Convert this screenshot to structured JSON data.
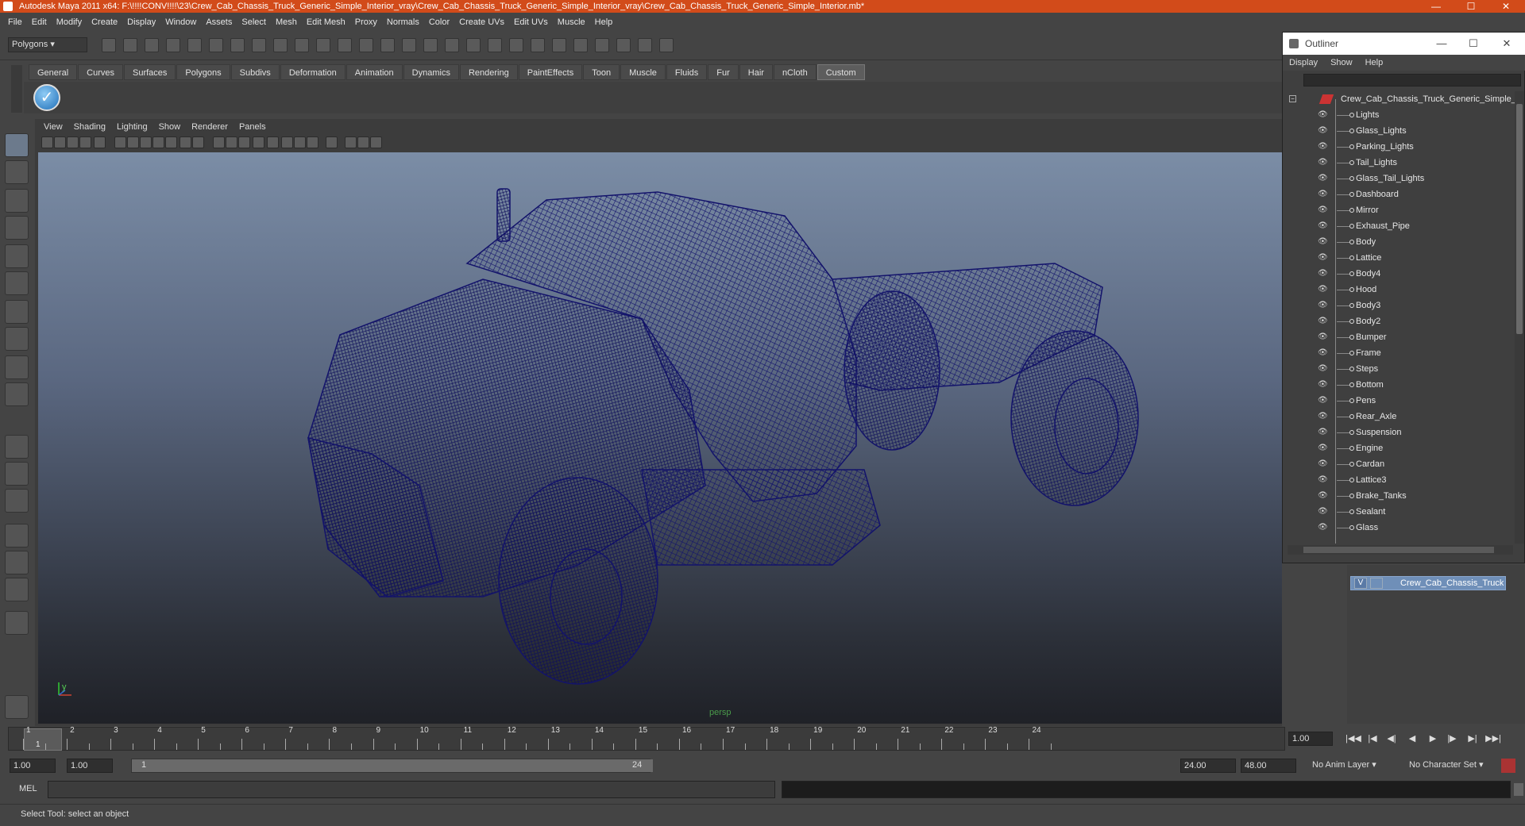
{
  "window": {
    "title": "Autodesk Maya 2011 x64: F:\\!!!!CONV!!!!\\23\\Crew_Cab_Chassis_Truck_Generic_Simple_Interior_vray\\Crew_Cab_Chassis_Truck_Generic_Simple_Interior_vray\\Crew_Cab_Chassis_Truck_Generic_Simple_Interior.mb*",
    "controls": {
      "minimize": "—",
      "maximize": "☐",
      "close": "✕"
    }
  },
  "menubar": [
    "File",
    "Edit",
    "Modify",
    "Create",
    "Display",
    "Window",
    "Assets",
    "Select",
    "Mesh",
    "Edit Mesh",
    "Proxy",
    "Normals",
    "Color",
    "Create UVs",
    "Edit UVs",
    "Muscle",
    "Help"
  ],
  "toolbar": {
    "mode": "Polygons"
  },
  "shelf": {
    "tabs": [
      "General",
      "Curves",
      "Surfaces",
      "Polygons",
      "Subdivs",
      "Deformation",
      "Animation",
      "Dynamics",
      "Rendering",
      "PaintEffects",
      "Toon",
      "Muscle",
      "Fluids",
      "Fur",
      "Hair",
      "nCloth",
      "Custom"
    ],
    "active_tab": "Custom",
    "button_glyph": "✓"
  },
  "viewport": {
    "menu": [
      "View",
      "Shading",
      "Lighting",
      "Show",
      "Renderer",
      "Panels"
    ],
    "camera": "persp",
    "axis_y": "y",
    "wire_color": "#13136b",
    "background_top": "#7b8da6",
    "background_bottom": "#1f2127"
  },
  "outliner": {
    "title": "Outliner",
    "menu": [
      "Display",
      "Show",
      "Help"
    ],
    "root": "Crew_Cab_Chassis_Truck_Generic_Simple_In",
    "items": [
      "Lights",
      "Glass_Lights",
      "Parking_Lights",
      "Tail_Lights",
      "Glass_Tail_Lights",
      "Dashboard",
      "Mirror",
      "Exhaust_Pipe",
      "Body",
      "Lattice",
      "Body4",
      "Hood",
      "Body3",
      "Body2",
      "Bumper",
      "Frame",
      "Steps",
      "Bottom",
      "Pens",
      "Rear_Axle",
      "Suspension",
      "Engine",
      "Cardan",
      "Lattice3",
      "Brake_Tanks",
      "Sealant",
      "Glass"
    ]
  },
  "layers": {
    "visible_flag": "V",
    "layer_name": "Crew_Cab_Chassis_Truck"
  },
  "timeline": {
    "ticks": [
      "1",
      "2",
      "3",
      "4",
      "5",
      "6",
      "7",
      "8",
      "9",
      "10",
      "11",
      "12",
      "13",
      "14",
      "15",
      "16",
      "17",
      "18",
      "19",
      "20",
      "21",
      "22",
      "23",
      "24"
    ],
    "current_frame": "1",
    "current_time_field": "1.00"
  },
  "range": {
    "start": "1.00",
    "playback_start": "1.00",
    "slider_start": "1",
    "slider_end": "24",
    "playback_end": "24.00",
    "end": "48.00",
    "anim_layer": "No Anim Layer",
    "character_set": "No Character Set"
  },
  "command": {
    "label": "MEL"
  },
  "help_line": "Select Tool: select an object"
}
